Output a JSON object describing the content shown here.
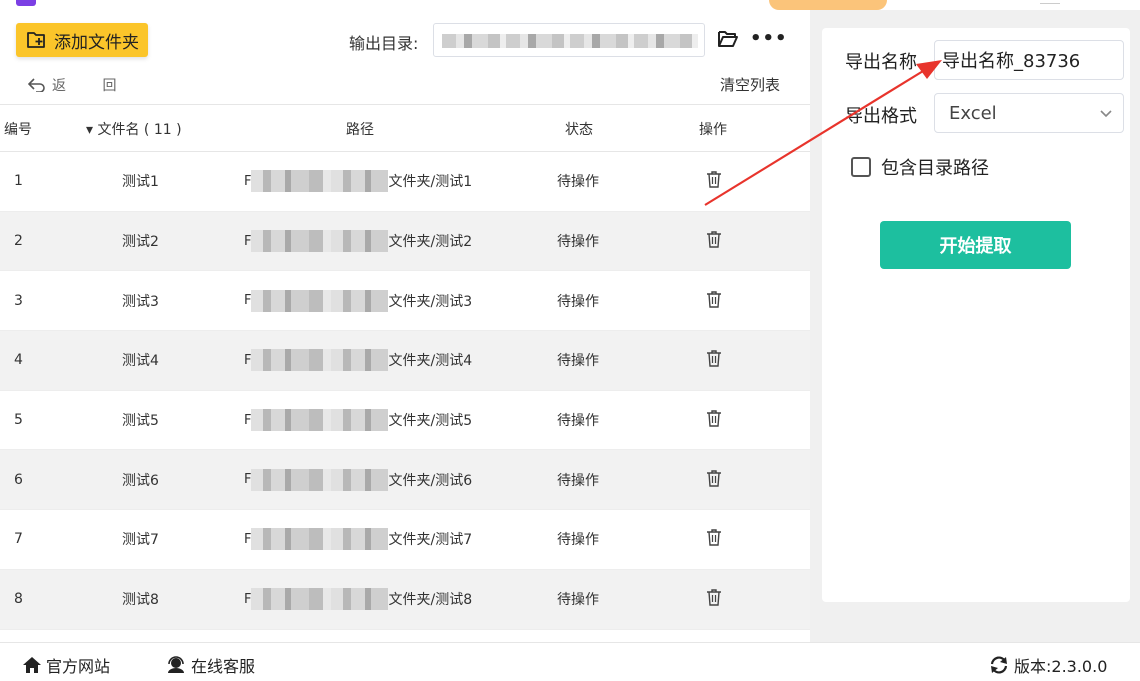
{
  "toolbar": {
    "add_folder_label": "添加文件夹",
    "output_dir_label": "输出目录:",
    "more_label": "•••",
    "undo_label": "返 回",
    "clear_list_label": "清空列表"
  },
  "table": {
    "headers": {
      "num": "编号",
      "name": "▾ 文件名 ( 11 )",
      "path": "路径",
      "status": "状态",
      "op": "操作"
    },
    "rows": [
      {
        "num": "1",
        "name": "测试1",
        "path_prefix": "F",
        "path_suffix": "文件夹/测试1",
        "status": "待操作"
      },
      {
        "num": "2",
        "name": "测试2",
        "path_prefix": "F",
        "path_suffix": "文件夹/测试2",
        "status": "待操作"
      },
      {
        "num": "3",
        "name": "测试3",
        "path_prefix": "F",
        "path_suffix": "文件夹/测试3",
        "status": "待操作"
      },
      {
        "num": "4",
        "name": "测试4",
        "path_prefix": "F",
        "path_suffix": "文件夹/测试4",
        "status": "待操作"
      },
      {
        "num": "5",
        "name": "测试5",
        "path_prefix": "F",
        "path_suffix": "文件夹/测试5",
        "status": "待操作"
      },
      {
        "num": "6",
        "name": "测试6",
        "path_prefix": "F",
        "path_suffix": "文件夹/测试6",
        "status": "待操作"
      },
      {
        "num": "7",
        "name": "测试7",
        "path_prefix": "F",
        "path_suffix": "文件夹/测试7",
        "status": "待操作"
      },
      {
        "num": "8",
        "name": "测试8",
        "path_prefix": "F",
        "path_suffix": "文件夹/测试8",
        "status": "待操作"
      }
    ]
  },
  "settings": {
    "export_name_label": "导出名称",
    "export_name_value": "导出名称_83736",
    "export_format_label": "导出格式",
    "export_format_value": "Excel",
    "include_path_label": "包含目录路径",
    "include_path_checked": false,
    "start_button_label": "开始提取"
  },
  "footer": {
    "site_label": "官方网站",
    "service_label": "在线客服",
    "version_label": "版本:2.3.0.0"
  },
  "colors": {
    "accent_yellow": "#fbc52a",
    "start_button": "#1dbf9f",
    "arrow_red": "#e8342c"
  },
  "icons": {
    "add_folder": "folder-plus-icon",
    "output_folder": "folder-open-icon",
    "undo": "undo-icon",
    "delete": "trash-icon",
    "select_chevron": "chevron-down-icon",
    "site": "home-icon",
    "service": "headset-icon",
    "version": "refresh-icon"
  }
}
